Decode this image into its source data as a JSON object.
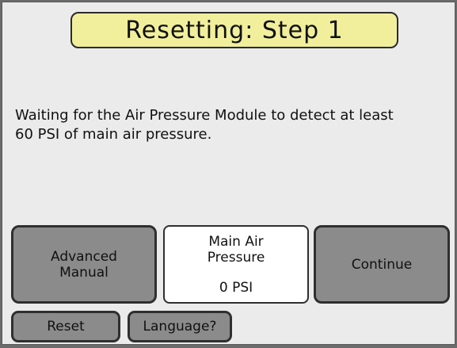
{
  "title": "Resetting:  Step  1",
  "message": "Waiting for the Air Pressure Module to detect at least\n 60 PSI of main air pressure.",
  "buttons": {
    "advanced_manual": "Advanced\nManual",
    "continue": "Continue",
    "reset": "Reset",
    "language": "Language?"
  },
  "pressure": {
    "label": "Main Air\nPressure",
    "value": "0  PSI"
  },
  "colors": {
    "title_background": "#f1ef9c",
    "screen_background": "#ebebeb",
    "button_background": "#8b8b8b",
    "readout_background": "#ffffff"
  }
}
